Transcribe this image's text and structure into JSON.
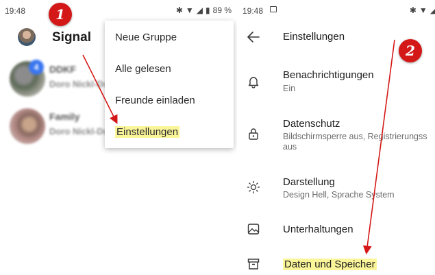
{
  "left": {
    "status": {
      "time": "19:48",
      "battery": "89 %"
    },
    "app_title": "Signal",
    "chats": [
      {
        "name": "DDKF",
        "preview": "Doro Nickl-Do",
        "unread": "4"
      },
      {
        "name": "Family",
        "preview": "Doro Nickl-Do"
      }
    ],
    "menu": {
      "items": [
        "Neue Gruppe",
        "Alle gelesen",
        "Freunde einladen",
        "Einstellungen"
      ]
    },
    "step": "1"
  },
  "right": {
    "status": {
      "time": "19:48"
    },
    "title": "Einstellungen",
    "rows": [
      {
        "title": "Benachrichtigungen",
        "subtitle": "Ein",
        "icon": "bell-icon"
      },
      {
        "title": "Datenschutz",
        "subtitle": "Bildschirmsperre aus, Registrierungss",
        "subtitle2": "aus",
        "icon": "lock-icon"
      },
      {
        "title": "Darstellung",
        "subtitle": "Design Hell, Sprache System",
        "icon": "sun-icon"
      },
      {
        "title": "Unterhaltungen",
        "icon": "image-icon"
      },
      {
        "title": "Daten und Speicher",
        "icon": "archive-icon"
      }
    ],
    "step": "2"
  },
  "colors": {
    "accent_red": "#d41717",
    "highlight": "#fbf59a",
    "badge_blue": "#3a76f0"
  }
}
